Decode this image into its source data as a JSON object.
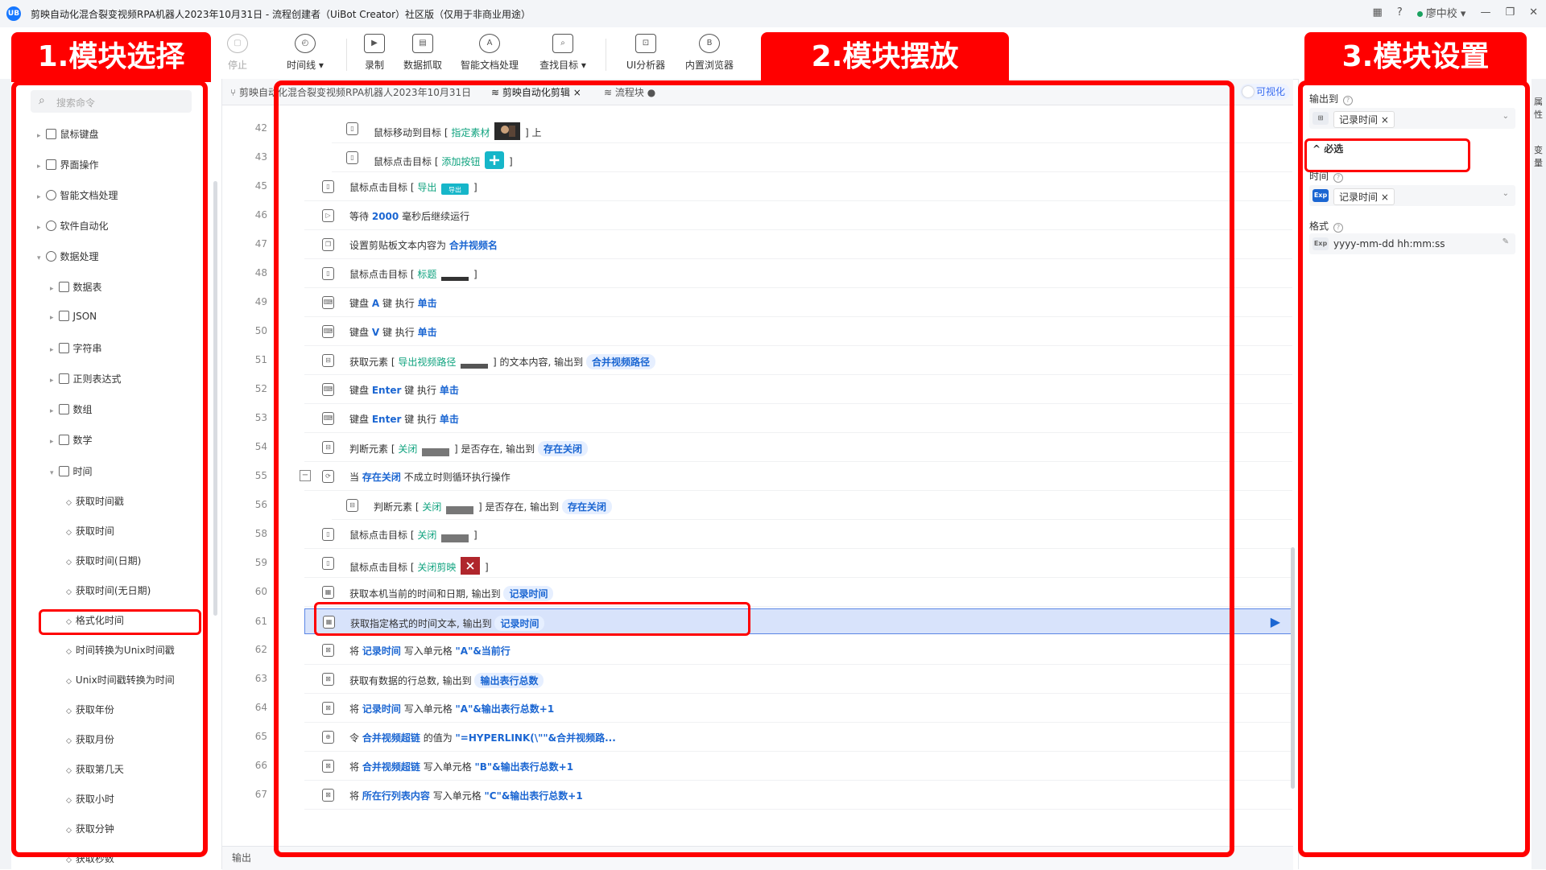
{
  "window": {
    "title": "剪映自动化混合裂变视频RPA机器人2023年10月31日 - 流程创建者（UiBot Creator）社区版（仅用于非商业用途）",
    "logo": "UB",
    "user": "廖中校",
    "help": "?"
  },
  "toolbar": {
    "stop": "停止",
    "timeline": "时间线 ▾",
    "record": "录制",
    "data_scrape": "数据抓取",
    "smart_doc": "智能文档处理",
    "find_target": "查找目标 ▾",
    "ui_analyzer": "UI分析器",
    "builtin_browser": "内置浏览器"
  },
  "annotations": {
    "left": "1.模块选择",
    "center": "2.模块摆放",
    "right": "3.模块设置"
  },
  "left_panel": {
    "search_placeholder": "搜索命令",
    "items": [
      {
        "label": "鼠标键盘"
      },
      {
        "label": "界面操作"
      },
      {
        "label": "智能文档处理"
      },
      {
        "label": "软件自动化"
      },
      {
        "label": "数据处理"
      },
      {
        "label": "数据表"
      },
      {
        "label": "JSON"
      },
      {
        "label": "字符串"
      },
      {
        "label": "正则表达式"
      },
      {
        "label": "数组"
      },
      {
        "label": "数学"
      },
      {
        "label": "时间"
      }
    ],
    "leaves": [
      {
        "label": "获取时间戳"
      },
      {
        "label": "获取时间"
      },
      {
        "label": "获取时间(日期)"
      },
      {
        "label": "获取时间(无日期)"
      },
      {
        "label": "格式化时间"
      },
      {
        "label": "时间转换为Unix时间戳"
      },
      {
        "label": "Unix时间戳转换为时间"
      },
      {
        "label": "获取年份"
      },
      {
        "label": "获取月份"
      },
      {
        "label": "获取第几天"
      },
      {
        "label": "获取小时"
      },
      {
        "label": "获取分钟"
      },
      {
        "label": "获取秒数"
      }
    ]
  },
  "tabs": [
    {
      "label": "剪映自动化混合裂变视频RPA机器人2023年10月31日"
    },
    {
      "label": "剪映自动化剪辑 ×"
    },
    {
      "label": "流程块 ●"
    }
  ],
  "visual_toggle": "可视化",
  "lines": [
    "42",
    "43",
    "45",
    "46",
    "47",
    "48",
    "49",
    "50",
    "51",
    "52",
    "53",
    "54",
    "55",
    "56",
    "58",
    "59",
    "60",
    "61",
    "62",
    "63",
    "64",
    "65",
    "66",
    "67"
  ],
  "rows": [
    {
      "a": "鼠标移动到目标 [",
      "b": "指定素材",
      "c": "] 上"
    },
    {
      "a": "鼠标点击目标 [",
      "b": "添加按钮",
      "c": "]"
    },
    {
      "a": "鼠标点击目标 [",
      "b": "导出",
      "c": "]"
    },
    {
      "a": "等待",
      "b": "2000",
      "c": "毫秒后继续运行"
    },
    {
      "a": "设置剪贴板文本内容为",
      "b": "合并视频名",
      "c": ""
    },
    {
      "a": "鼠标点击目标 [",
      "b": "标题",
      "c": "]"
    },
    {
      "a": "键盘",
      "b": "A",
      "c": "键 执行",
      "d": "单击"
    },
    {
      "a": "键盘",
      "b": "V",
      "c": "键 执行",
      "d": "单击"
    },
    {
      "a": "获取元素 [",
      "b": "导出视频路径",
      "c": "] 的文本内容, 输出到",
      "d": "合并视频路径"
    },
    {
      "a": "键盘",
      "b": "Enter",
      "c": "键 执行",
      "d": "单击"
    },
    {
      "a": "键盘",
      "b": "Enter",
      "c": "键 执行",
      "d": "单击"
    },
    {
      "a": "判断元素 [",
      "b": "关闭",
      "c": "] 是否存在, 输出到",
      "d": "存在关闭"
    },
    {
      "a": "当",
      "b": "存在关闭",
      "c": "不成立时则循环执行操作"
    },
    {
      "a": "判断元素 [",
      "b": "关闭",
      "c": "] 是否存在, 输出到",
      "d": "存在关闭"
    },
    {
      "a": "鼠标点击目标 [",
      "b": "关闭",
      "c": "]"
    },
    {
      "a": "鼠标点击目标 [",
      "b": "关闭剪映",
      "c": "]"
    },
    {
      "a": "获取本机当前的时间和日期, 输出到",
      "b": "记录时间",
      "c": ""
    },
    {
      "a": "获取指定格式的时间文本, 输出到",
      "b": "记录时间",
      "c": ""
    },
    {
      "a": "将",
      "b": "记录时间",
      "c": "写入单元格",
      "d": "\"A\"&当前行"
    },
    {
      "a": "获取有数据的行总数, 输出到",
      "b": "输出表行总数",
      "c": ""
    },
    {
      "a": "将",
      "b": "记录时间",
      "c": "写入单元格",
      "d": "\"A\"&输出表行总数+1"
    },
    {
      "a": "令",
      "b": "合并视频超链",
      "c": "的值为",
      "d": "\"=HYPERLINK(\\\"\"&合并视频路..."
    },
    {
      "a": "将",
      "b": "合并视频超链",
      "c": "写入单元格",
      "d": "\"B\"&输出表行总数+1"
    },
    {
      "a": "将",
      "b": "所在行列表内容",
      "c": "写入单元格",
      "d": "\"C\"&输出表行总数+1"
    }
  ],
  "thumb_labels": {
    "export": "导出"
  },
  "output_label": "输出",
  "right_panel": {
    "output_to": "输出到",
    "output_value": "记录时间 ×",
    "required_section": "^ 必选",
    "time_label": "时间",
    "time_value": "记录时间 ×",
    "format_label": "格式",
    "format_value": "yyyy-mm-dd hh:mm:ss",
    "exp": "Exp",
    "side_tab_1": "属性",
    "side_tab_2": "变量"
  },
  "colors": {
    "annotation": "#ff0000",
    "link": "#1b66d2",
    "target": "#10a37f",
    "selection": "#d8e3fb"
  }
}
